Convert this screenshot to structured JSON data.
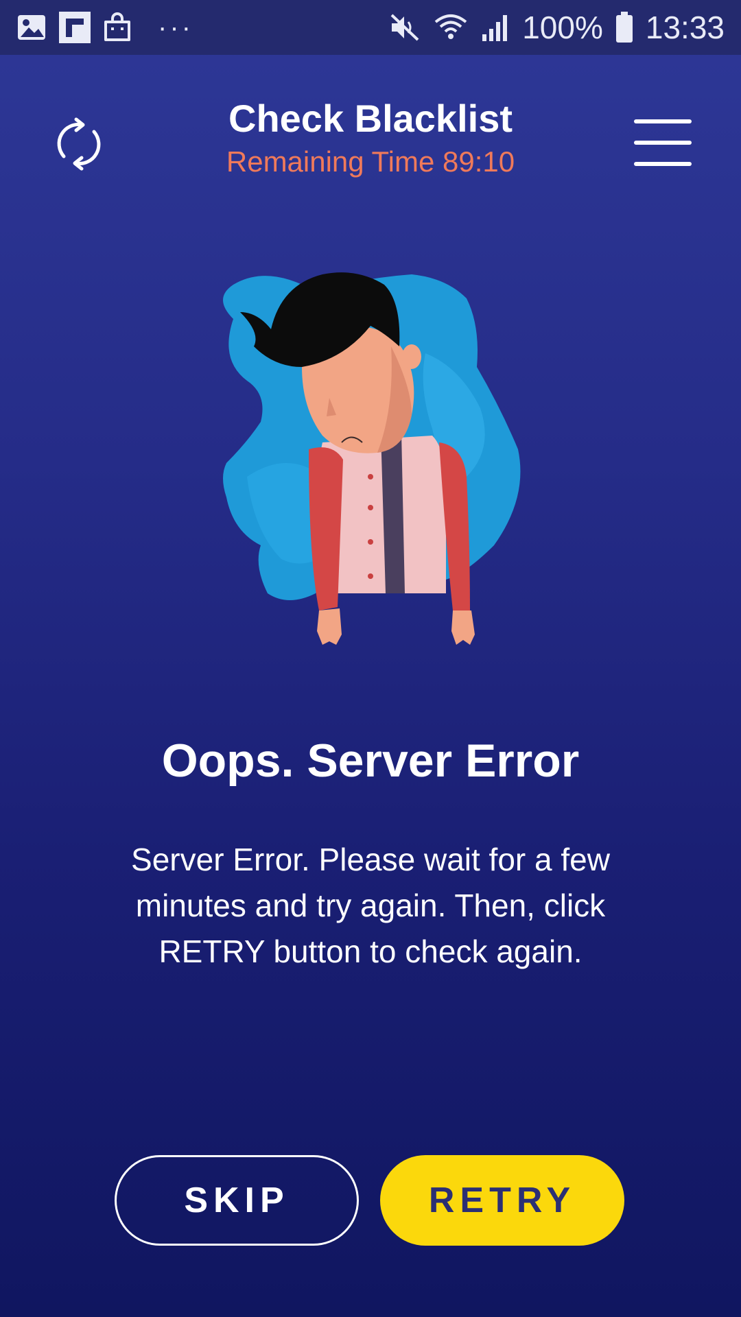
{
  "status_bar": {
    "icons": [
      "gallery-icon",
      "flipboard-icon",
      "shopping-bag-icon"
    ],
    "more": "···",
    "right_icons": [
      "mute-icon",
      "wifi-icon",
      "signal-icon"
    ],
    "battery_percent": "100%",
    "time": "13:33"
  },
  "header": {
    "title": "Check Blacklist",
    "subtitle": "Remaining Time 89:10",
    "left_icon": "refresh-icon",
    "right_icon": "hamburger-menu-icon"
  },
  "illustration": {
    "icon": "sad-man-illustration"
  },
  "error": {
    "title": "Oops. Server Error",
    "message": "Server Error. Please wait for a few minutes and try again. Then, click RETRY button to check again."
  },
  "buttons": {
    "skip": "SKIP",
    "retry": "RETRY"
  },
  "colors": {
    "accent": "#fbd80c",
    "subtitle": "#f07a5a",
    "background_top": "#2e3897",
    "background_bottom": "#101660"
  }
}
